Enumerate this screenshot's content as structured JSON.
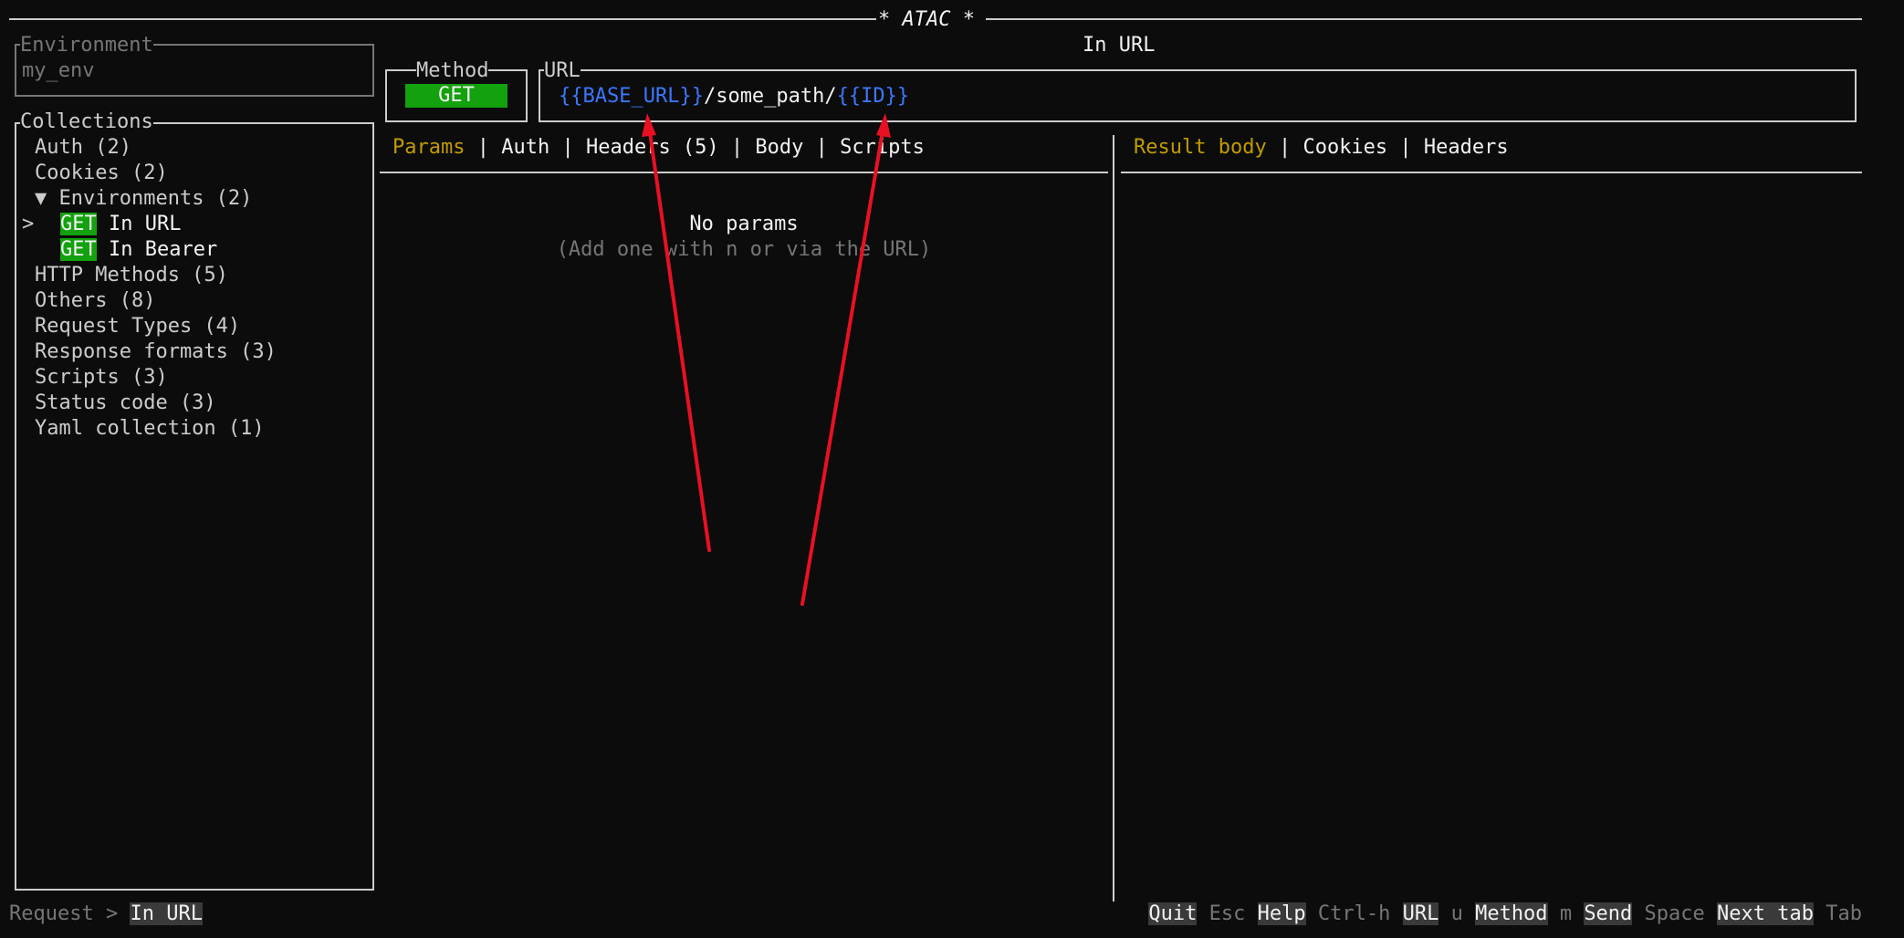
{
  "app": {
    "title": "* ATAC *",
    "request_title": "In URL"
  },
  "environment": {
    "label": "Environment",
    "value": "my_env"
  },
  "collections": {
    "label": "Collections",
    "items": [
      {
        "text": "Auth (2)"
      },
      {
        "text": "Cookies (2)"
      },
      {
        "text": "Environments (2)",
        "arrow": "▼"
      },
      {
        "method": "GET",
        "name": "In URL",
        "marker": ">"
      },
      {
        "method": "GET",
        "name": "In Bearer"
      },
      {
        "text": "HTTP Methods (5)"
      },
      {
        "text": "Others (8)"
      },
      {
        "text": "Request Types (4)"
      },
      {
        "text": "Response formats (3)"
      },
      {
        "text": "Scripts (3)"
      },
      {
        "text": "Status code (3)"
      },
      {
        "text": "Yaml collection (1)"
      }
    ]
  },
  "method": {
    "label": "Method",
    "value": "GET"
  },
  "url": {
    "label": "URL",
    "var1": "{{BASE_URL}}",
    "path": "/some_path/",
    "var2": "{{ID}}"
  },
  "request_tabs": [
    "Params",
    "Auth",
    "Headers (5)",
    "Body",
    "Scripts"
  ],
  "tab_separator": "|",
  "params": {
    "empty_title": "No params",
    "empty_hint": "(Add one with n or via the URL)"
  },
  "result_tabs": [
    "Result body",
    "Cookies",
    "Headers"
  ],
  "footer": {
    "breadcrumb_prefix": "Request >",
    "breadcrumb_current": "In URL",
    "keys": [
      {
        "label": "Quit",
        "key": "Esc"
      },
      {
        "label": "Help",
        "key": "Ctrl-h"
      },
      {
        "label": "URL",
        "key": "u"
      },
      {
        "label": "Method",
        "key": "m"
      },
      {
        "label": "Send",
        "key": "Space"
      },
      {
        "label": "Next tab",
        "key": "Tab"
      }
    ]
  },
  "colors": {
    "background": "#0c0c0c",
    "text": "#cccccc",
    "accent_green": "#13a10e",
    "active_tab": "#c19c00",
    "url_variable": "#3b78ff",
    "annotation_arrow": "#e81123"
  }
}
